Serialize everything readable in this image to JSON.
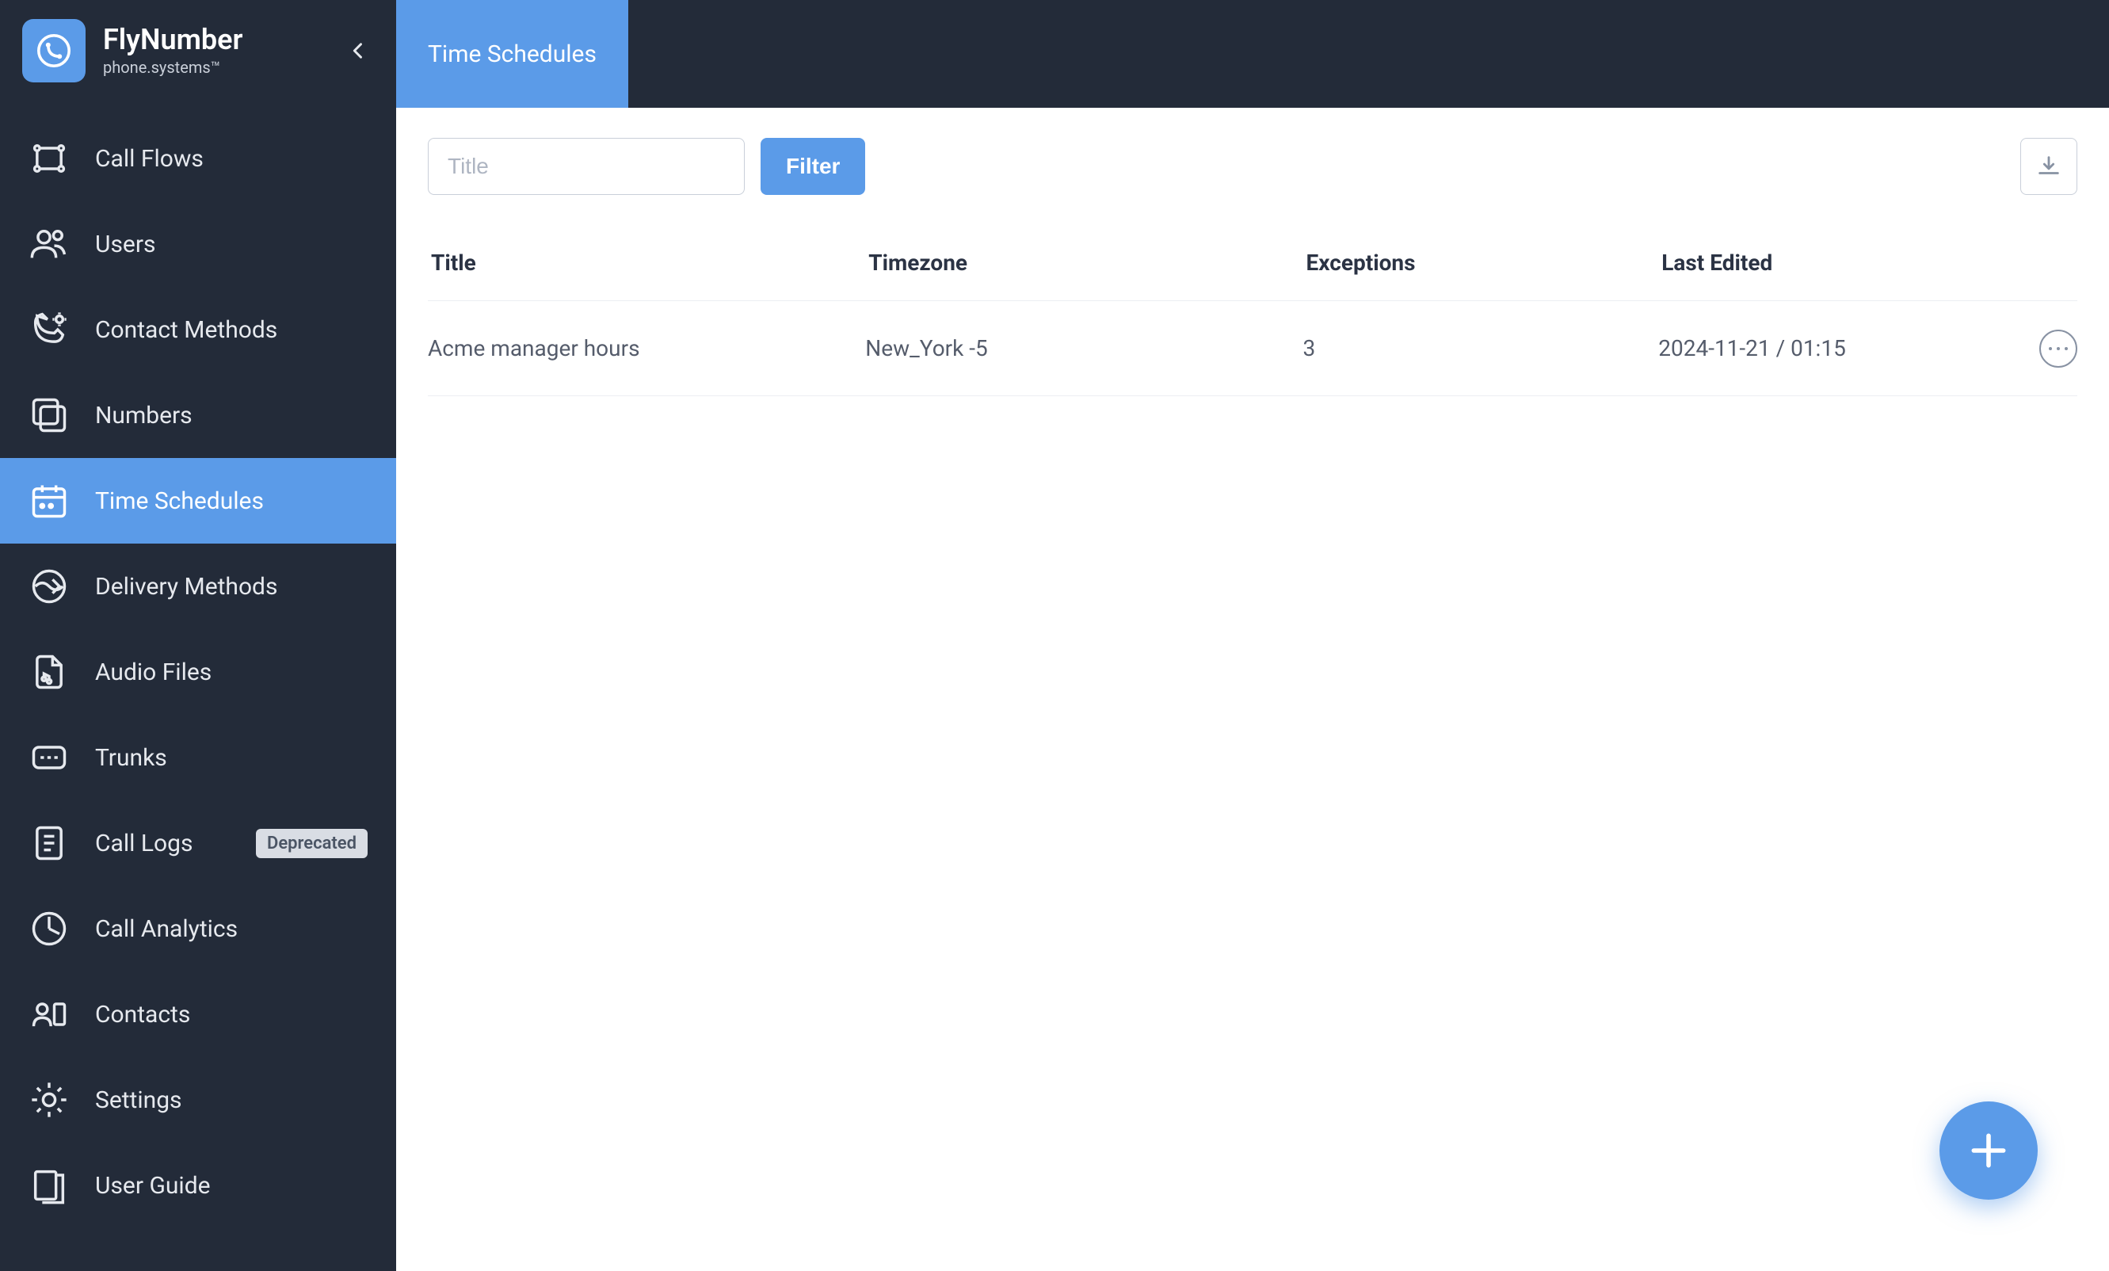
{
  "brand": {
    "title": "FlyNumber",
    "subtitle": "phone.systems™"
  },
  "sidebar": {
    "items": [
      {
        "label": "Call Flows",
        "icon": "call-flows-icon",
        "active": false
      },
      {
        "label": "Users",
        "icon": "users-icon",
        "active": false
      },
      {
        "label": "Contact Methods",
        "icon": "contact-methods-icon",
        "active": false
      },
      {
        "label": "Numbers",
        "icon": "numbers-icon",
        "active": false
      },
      {
        "label": "Time Schedules",
        "icon": "calendar-icon",
        "active": true
      },
      {
        "label": "Delivery Methods",
        "icon": "delivery-icon",
        "active": false
      },
      {
        "label": "Audio Files",
        "icon": "audio-icon",
        "active": false
      },
      {
        "label": "Trunks",
        "icon": "trunks-icon",
        "active": false
      },
      {
        "label": "Call Logs",
        "icon": "log-icon",
        "active": false,
        "badge": "Deprecated"
      },
      {
        "label": "Call Analytics",
        "icon": "analytics-icon",
        "active": false
      },
      {
        "label": "Contacts",
        "icon": "contacts-icon",
        "active": false
      },
      {
        "label": "Settings",
        "icon": "gear-icon",
        "active": false
      },
      {
        "label": "User Guide",
        "icon": "guide-icon",
        "active": false
      }
    ]
  },
  "header": {
    "tab": "Time Schedules"
  },
  "filters": {
    "title_placeholder": "Title",
    "filter_button": "Filter"
  },
  "table": {
    "columns": [
      "Title",
      "Timezone",
      "Exceptions",
      "Last Edited"
    ],
    "rows": [
      {
        "title": "Acme manager hours",
        "timezone": "New_York -5",
        "exceptions": "3",
        "last_edited": "2024-11-21 / 01:15"
      }
    ]
  }
}
